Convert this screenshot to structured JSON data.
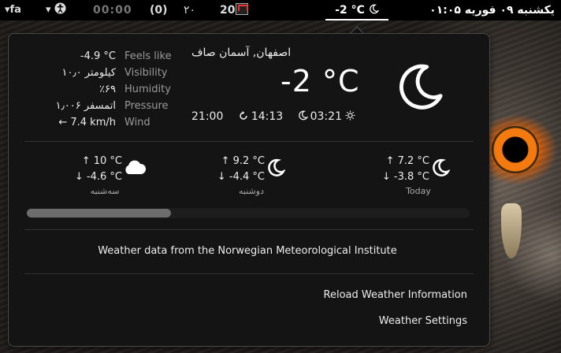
{
  "panel": {
    "keyboard": "▾fa",
    "accessibility": "▾",
    "clock_secondary": "00:00",
    "paren": "(0)",
    "number": "٢٠",
    "mail_count": "20",
    "weather_indicator": "-2 °C",
    "datetime": "یکشنبه ۰۹ فوریه ۰۱:۰۵"
  },
  "current": {
    "location": "اصفهان, آسمان صاف",
    "temperature": "-2 °C",
    "details": [
      {
        "label": "Feels like",
        "value": "-4.9 °C"
      },
      {
        "label": "Visibility",
        "value": "۱۰٫۰ کیلومتر"
      },
      {
        "label": "Humidity",
        "value": "٪۶۹"
      },
      {
        "label": "Pressure",
        "value": "۱٫۰۰۶ اتمسفر"
      },
      {
        "label": "Wind",
        "value": "← 7.4 km/h"
      }
    ],
    "build_time": "21:00",
    "sunrise": "14:13",
    "sunset": "03:21"
  },
  "forecast": [
    {
      "day": "سه‌شنبه",
      "high": "↑ 10 °C",
      "low": "↓ -4.6 °C",
      "icon": "cloud-icon"
    },
    {
      "day": "دوشنبه",
      "high": "↑ 9.2 °C",
      "low": "↓ -4.4 °C",
      "icon": "moon-icon"
    },
    {
      "day": "Today",
      "high": "↑ 7.2 °C",
      "low": "↓ -3.8 °C",
      "icon": "moon-icon"
    }
  ],
  "credit": "Weather data from the Norwegian Meteorological Institute",
  "menu": {
    "reload": "Reload Weather Information",
    "settings": "Weather Settings"
  },
  "colors": {
    "menu_background": "#141414",
    "label_gray": "#9a9a9a",
    "owl_eye_orange": "#f47a10"
  }
}
